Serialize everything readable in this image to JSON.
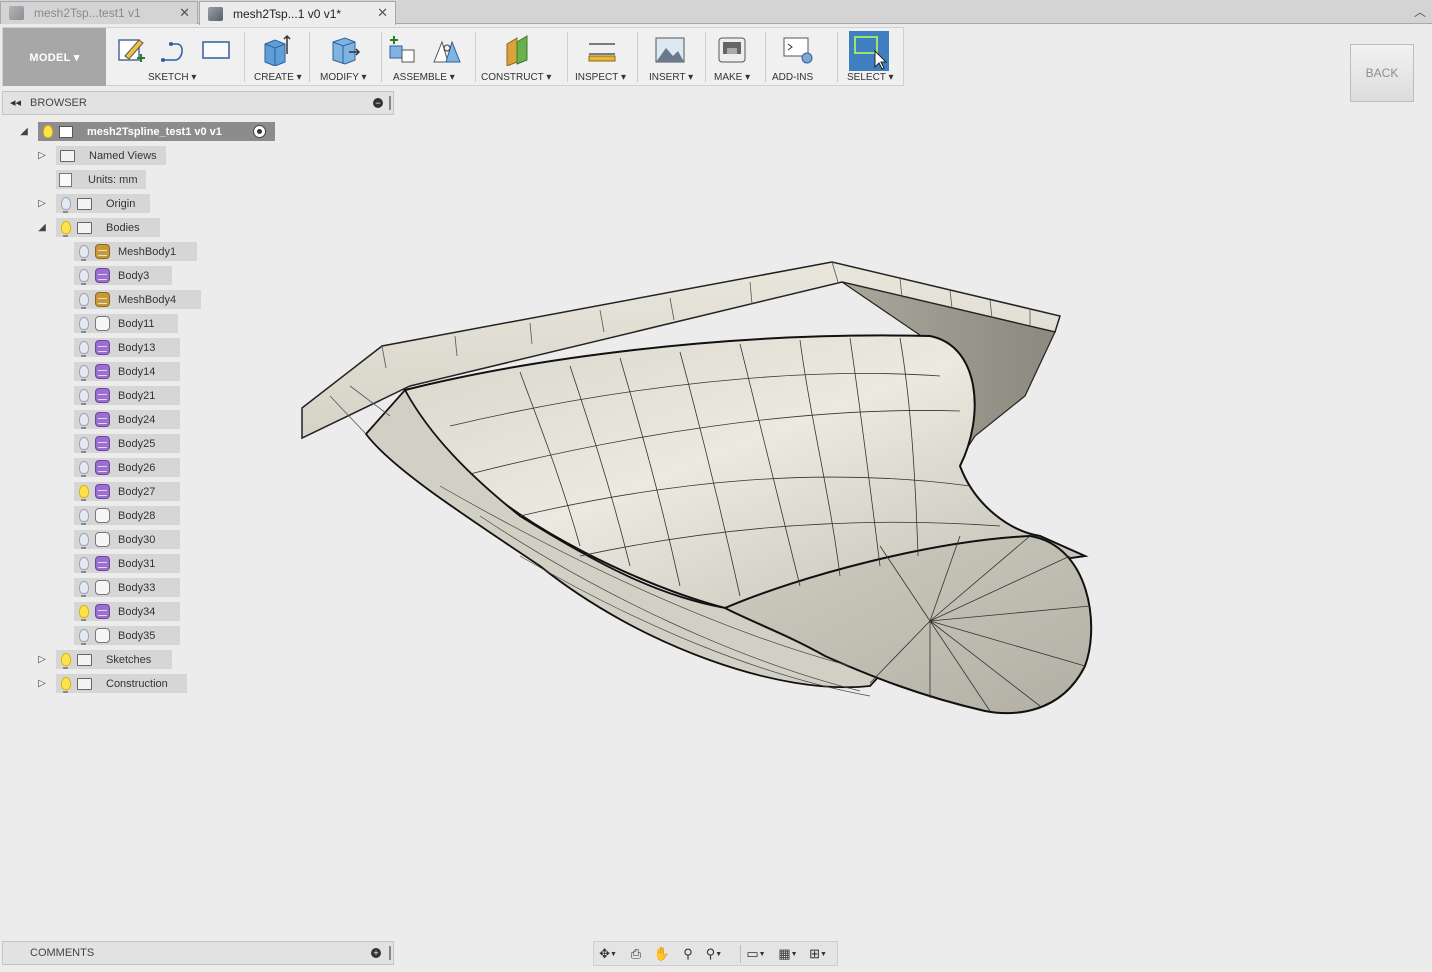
{
  "tabs": [
    {
      "label": "mesh2Tsp...test1 v1",
      "active": false
    },
    {
      "label": "mesh2Tsp...1 v0 v1*",
      "active": true
    }
  ],
  "toolbar": {
    "workspace": "MODEL ▾",
    "groups": [
      {
        "label": "SKETCH ▾"
      },
      {
        "label": "CREATE ▾"
      },
      {
        "label": "MODIFY ▾"
      },
      {
        "label": "ASSEMBLE ▾"
      },
      {
        "label": "CONSTRUCT ▾"
      },
      {
        "label": "INSPECT ▾"
      },
      {
        "label": "INSERT ▾"
      },
      {
        "label": "MAKE ▾"
      },
      {
        "label": "ADD-INS"
      },
      {
        "label": "SELECT ▾"
      }
    ]
  },
  "browser": {
    "title": "BROWSER",
    "root": {
      "label": "mesh2Tspline_test1 v0 v1"
    },
    "nodes": [
      {
        "label": "Named Views"
      },
      {
        "label": "Units: mm"
      },
      {
        "label": "Origin"
      },
      {
        "label": "Bodies"
      },
      {
        "label": "Sketches"
      },
      {
        "label": "Construction"
      }
    ],
    "bodies": [
      {
        "label": "MeshBody1",
        "icon": "mesh-body-icon",
        "visible": false
      },
      {
        "label": "Body3",
        "icon": "tspline-body-icon",
        "visible": false
      },
      {
        "label": "MeshBody4",
        "icon": "mesh-body-icon",
        "visible": false
      },
      {
        "label": "Body11",
        "icon": "solid-body-icon",
        "visible": false
      },
      {
        "label": "Body13",
        "icon": "tspline-body-icon",
        "visible": false
      },
      {
        "label": "Body14",
        "icon": "tspline-body-icon",
        "visible": false
      },
      {
        "label": "Body21",
        "icon": "tspline-body-icon",
        "visible": false
      },
      {
        "label": "Body24",
        "icon": "tspline-body-icon",
        "visible": false
      },
      {
        "label": "Body25",
        "icon": "tspline-body-icon",
        "visible": false
      },
      {
        "label": "Body26",
        "icon": "tspline-body-icon",
        "visible": false
      },
      {
        "label": "Body27",
        "icon": "tspline-body-icon",
        "visible": true
      },
      {
        "label": "Body28",
        "icon": "solid-body-icon",
        "visible": false
      },
      {
        "label": "Body30",
        "icon": "solid-body-icon",
        "visible": false
      },
      {
        "label": "Body31",
        "icon": "tspline-body-icon",
        "visible": false
      },
      {
        "label": "Body33",
        "icon": "solid-body-icon",
        "visible": false
      },
      {
        "label": "Body34",
        "icon": "tspline-body-icon",
        "visible": true
      },
      {
        "label": "Body35",
        "icon": "solid-body-icon",
        "visible": false
      }
    ]
  },
  "viewcube": {
    "label": "BACK"
  },
  "comments": {
    "title": "COMMENTS"
  },
  "colors": {
    "select_accent": "#3f7fbf",
    "bulb_on": "#ffe34d",
    "tspline": "#9b6fd0",
    "mesh": "#c69a36"
  }
}
